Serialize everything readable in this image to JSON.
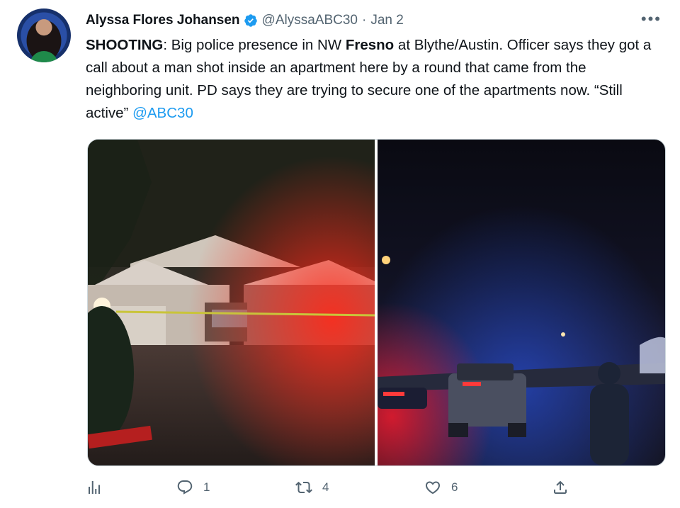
{
  "tweet": {
    "author_name": "Alyssa Flores Johansen",
    "handle": "@AlyssaABC30",
    "separator": "·",
    "date": "Jan 2",
    "more": "•••",
    "text": {
      "p1": "SHOOTING",
      "p2": ": Big police presence in NW ",
      "p3": "Fresno",
      "p4": " at Blythe/Austin. Officer says they got a call about a man shot inside an apartment here by a round that came from the neighboring unit. PD says they are trying to secure one of the apartments now. “Still active” ",
      "mention": "@ABC30"
    }
  },
  "actions": {
    "analytics": {
      "icon": "analytics-icon"
    },
    "reply": {
      "icon": "reply-icon",
      "count": "1"
    },
    "retweet": {
      "icon": "retweet-icon",
      "count": "4"
    },
    "like": {
      "icon": "heart-icon",
      "count": "6"
    },
    "share": {
      "icon": "share-icon"
    }
  },
  "colors": {
    "accent": "#1d9bf0",
    "secondary_text": "#536471"
  }
}
